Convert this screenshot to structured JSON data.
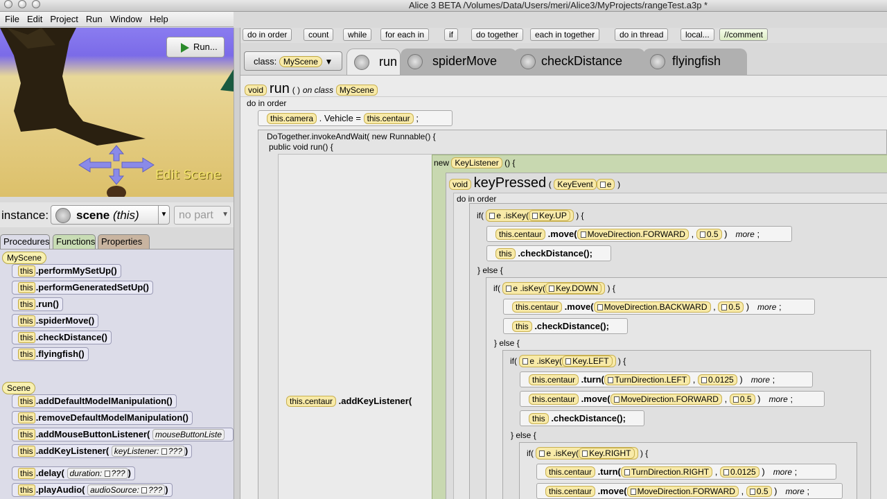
{
  "window": {
    "title": "Alice  3 BETA  /Volumes/Data/Users/meri/Alice3/MyProjects/rangeTest.a3p *"
  },
  "menu": [
    "File",
    "Edit",
    "Project",
    "Run",
    "Window",
    "Help"
  ],
  "scene": {
    "run_label": "Run...",
    "edit_scene_label": "Edit Scene"
  },
  "instance": {
    "label": "instance:",
    "name": "scene",
    "suffix": "(this)",
    "part": "no part"
  },
  "left_tabs": [
    "Procedures",
    "Functions",
    "Properties"
  ],
  "groups": {
    "myscene": "MyScene",
    "scene": "Scene"
  },
  "procs_myscene": [
    ".performMySetUp()",
    ".performGeneratedSetUp()",
    ".run()",
    ".spiderMove()",
    ".checkDistance()",
    ".flyingfish()"
  ],
  "procs_scene": [
    ".addDefaultModelManipulation()",
    ".removeDefaultModelManipulation()",
    ".addMouseButtonListener(",
    ".addKeyListener(",
    ".delay(",
    ".playAudio("
  ],
  "proc_params": {
    "mouse": "mouseButtonListe",
    "key": "keyListener:",
    "delay": "duration:",
    "audio": "audioSource:",
    "unknown": "???"
  },
  "this_label": "this",
  "toolbar": [
    "do in order",
    "count",
    "while",
    "for each in",
    "if",
    "do together",
    "each in together",
    "do in thread",
    "local...",
    "//comment"
  ],
  "class_selector": {
    "label": "class:",
    "value": "MyScene"
  },
  "method_tabs": [
    "run",
    "spiderMove",
    "checkDistance",
    "flyingfish"
  ],
  "editor": {
    "void": "void",
    "method_name": "run",
    "parens": "( )",
    "on_class": "on class",
    "class_name": "MyScene",
    "do_in_order": "do in order",
    "camera_line": {
      "target": "this.camera",
      "mid": ". Vehicle =",
      "value": "this.centaur",
      "end": ";"
    },
    "dotogether": "DoTogether.invokeAndWait( new Runnable() {",
    "public_run": "public void run() {",
    "new_kw": "new",
    "key_listener": "KeyListener",
    "kl_suffix": "() {",
    "key_pressed": "keyPressed",
    "key_event": "KeyEvent",
    "e": "e",
    "centaur": "this.centaur",
    "add_key_listener": ".addKeyListener(",
    "if": "if(",
    "else": "} else {",
    "iskey": ".isKey(",
    "close_if": ") {",
    "keys": [
      "Key.UP",
      "Key.DOWN",
      "Key.LEFT",
      "Key.RIGHT"
    ],
    "move": ".move(",
    "turn": ".turn(",
    "check": ".checkDistance();",
    "dir_forward": "MoveDirection.FORWARD",
    "dir_backward": "MoveDirection.BACKWARD",
    "turn_left": "TurnDirection.LEFT",
    "turn_right": "TurnDirection.RIGHT",
    "amt": "0.5",
    "turn_amt": "0.0125",
    "more": "more",
    "semi": ";",
    "comma": ",",
    "rparen": ")"
  }
}
